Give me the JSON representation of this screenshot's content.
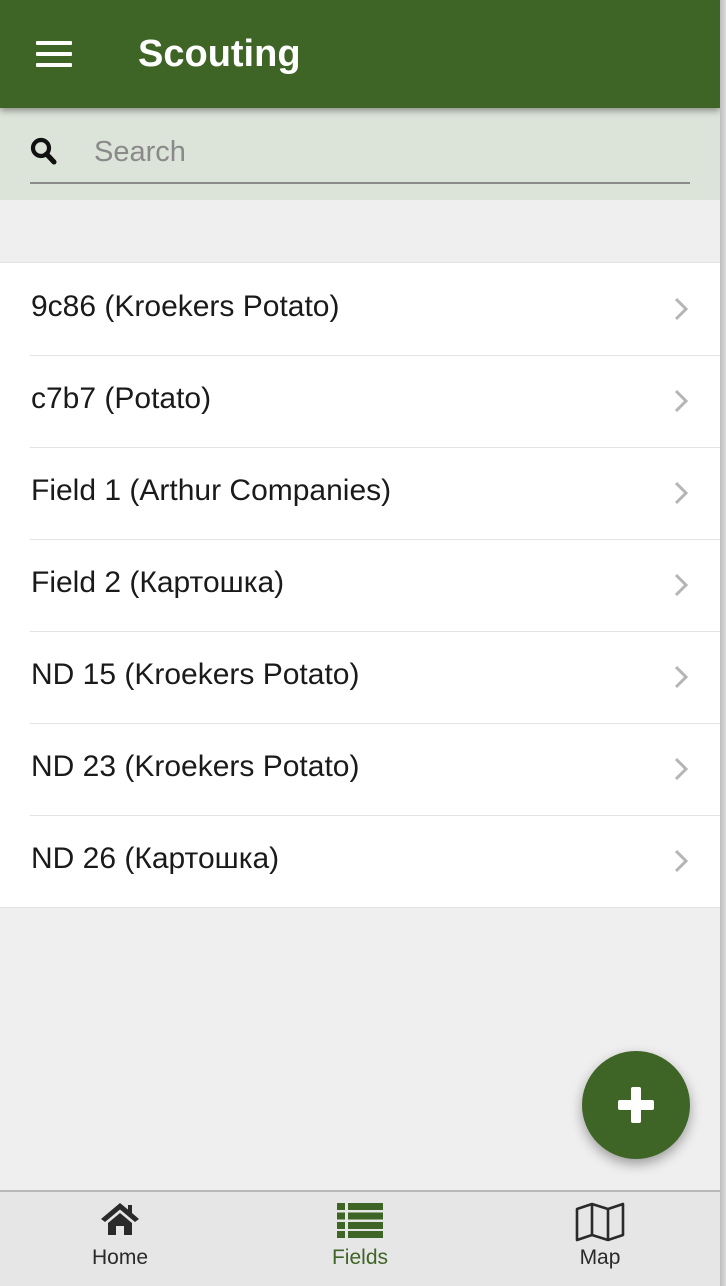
{
  "header": {
    "title": "Scouting",
    "menu_icon": "hamburger-menu-icon",
    "color": "#3f6526"
  },
  "search": {
    "placeholder": "Search",
    "value": "",
    "icon": "search-icon",
    "background": "#dce3d8"
  },
  "fields": [
    {
      "label": "9c86 (Kroekers Potato)"
    },
    {
      "label": "c7b7 (Potato)"
    },
    {
      "label": "Field 1 (Arthur Companies)"
    },
    {
      "label": "Field 2 (Картошка)"
    },
    {
      "label": "ND 15 (Kroekers Potato)"
    },
    {
      "label": "ND 23 (Kroekers Potato)"
    },
    {
      "label": "ND 26 (Картошка)"
    }
  ],
  "fab": {
    "icon": "plus-icon"
  },
  "bottom_nav": {
    "items": [
      {
        "label": "Home",
        "icon": "home-icon",
        "active": false
      },
      {
        "label": "Fields",
        "icon": "list-icon",
        "active": true
      },
      {
        "label": "Map",
        "icon": "map-icon",
        "active": false
      }
    ],
    "active_color": "#3f6526"
  }
}
